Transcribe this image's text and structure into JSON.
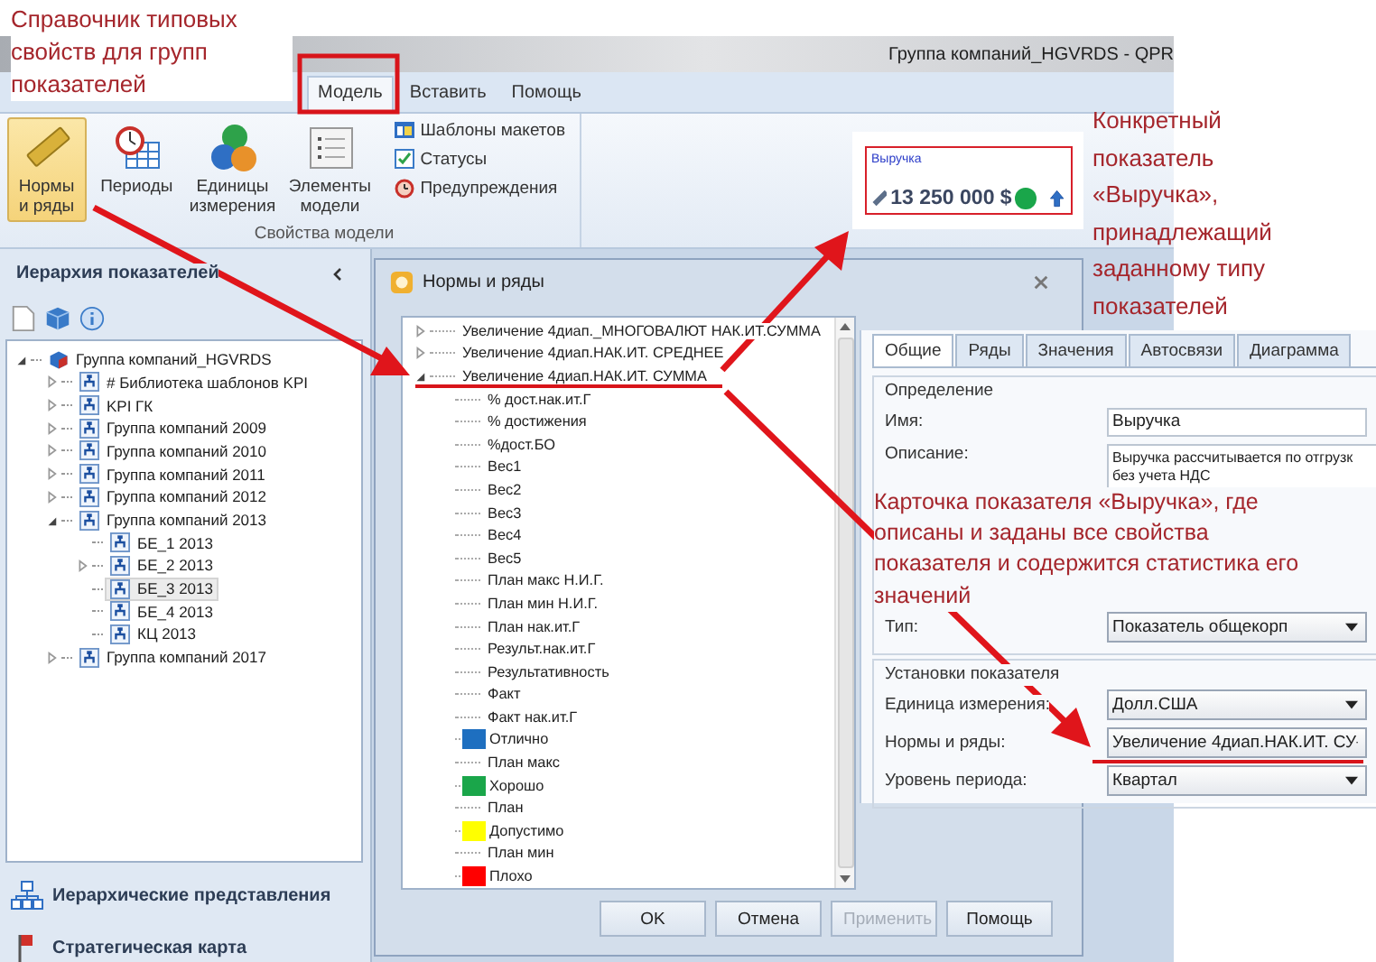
{
  "window": {
    "title": "Группа компаний_HGVRDS - QPR"
  },
  "menu": [
    {
      "label": "Модель",
      "selected": true
    },
    {
      "label": "Вставить",
      "selected": false
    },
    {
      "label": "Помощь",
      "selected": false
    }
  ],
  "ribbon": {
    "buttons": [
      {
        "lines": [
          "Нормы",
          "и ряды"
        ],
        "selected": true
      },
      {
        "lines": [
          "Периоды"
        ],
        "selected": false
      },
      {
        "lines": [
          "Единицы",
          "измерения"
        ],
        "selected": false
      },
      {
        "lines": [
          "Элементы",
          "модели"
        ],
        "selected": false
      }
    ],
    "small_items": [
      {
        "label": "Шаблоны макетов"
      },
      {
        "label": "Статусы"
      },
      {
        "label": "Предупреждения"
      }
    ],
    "group_label": "Свойства модели"
  },
  "hierarchy": {
    "title": "Иерархия показателей",
    "tree": [
      {
        "label": "Группа компаний_HGVRDS",
        "expanded": true,
        "selected": false,
        "children": [
          {
            "label": "# Библиотека шаблонов KPI",
            "expanded": false,
            "selected": false
          },
          {
            "label": "KPI ГК",
            "expanded": false,
            "selected": false
          },
          {
            "label": "Группа компаний 2009",
            "expanded": false,
            "selected": false
          },
          {
            "label": "Группа компаний 2010",
            "expanded": false,
            "selected": false
          },
          {
            "label": "Группа компаний 2011",
            "expanded": false,
            "selected": false
          },
          {
            "label": "Группа компаний 2012",
            "expanded": false,
            "selected": false
          },
          {
            "label": "Группа компаний 2013",
            "expanded": true,
            "selected": false,
            "children": [
              {
                "label": "БЕ_1 2013",
                "selected": false
              },
              {
                "label": "БЕ_2 2013",
                "expanded": false,
                "selected": false
              },
              {
                "label": "БЕ_3 2013",
                "selected": true
              },
              {
                "label": "БЕ_4 2013",
                "selected": false
              },
              {
                "label": "КЦ 2013",
                "selected": false
              }
            ]
          },
          {
            "label": "Группа компаний 2017",
            "expanded": false,
            "selected": false
          }
        ]
      }
    ],
    "nav": [
      {
        "label": "Иерархические представления"
      },
      {
        "label": "Стратегическая карта"
      }
    ]
  },
  "dialog": {
    "title": "Нормы и ряды",
    "tree": [
      {
        "label": "Увеличение 4диап._МНОГОВАЛЮТ НАК.ИТ.СУММА",
        "expanded": false
      },
      {
        "label": "Увеличение 4диап.НАК.ИТ. СРЕДНЕЕ",
        "expanded": false
      },
      {
        "label": "Увеличение 4диап.НАК.ИТ. СУММА",
        "expanded": true,
        "children": [
          {
            "label": "% дост.нак.ит.Г"
          },
          {
            "label": "% достижения"
          },
          {
            "label": "%дост.БО"
          },
          {
            "label": "Вес1"
          },
          {
            "label": "Вес2"
          },
          {
            "label": "Вес3"
          },
          {
            "label": "Вес4"
          },
          {
            "label": "Вес5"
          },
          {
            "label": "План макс Н.И.Г."
          },
          {
            "label": "План мин Н.И.Г."
          },
          {
            "label": "План нак.ит.Г"
          },
          {
            "label": "Результ.нак.ит.Г"
          },
          {
            "label": "Результативность"
          },
          {
            "label": "Факт"
          },
          {
            "label": "Факт нак.ит.Г"
          },
          {
            "label": "Отлично",
            "color": "#1e6fc0"
          },
          {
            "label": "План макс"
          },
          {
            "label": "Хорошо",
            "color": "#1aa64a"
          },
          {
            "label": "План"
          },
          {
            "label": "Допустимо",
            "color": "#ffff00"
          },
          {
            "label": "План мин"
          },
          {
            "label": "Плохо",
            "color": "#ff0000"
          }
        ]
      }
    ],
    "buttons": [
      {
        "label": "OK",
        "disabled": false
      },
      {
        "label": "Отмена",
        "disabled": false
      },
      {
        "label": "Применить",
        "disabled": true
      },
      {
        "label": "Помощь",
        "disabled": false
      }
    ]
  },
  "kpi_widget": {
    "title": "Выручка",
    "value": "13 250 000 $"
  },
  "card": {
    "tabs": [
      {
        "label": "Общие",
        "selected": true
      },
      {
        "label": "Ряды",
        "selected": false
      },
      {
        "label": "Значения",
        "selected": false
      },
      {
        "label": "Автосвязи",
        "selected": false
      },
      {
        "label": "Диаграмма",
        "selected": false
      }
    ],
    "definition": {
      "legend": "Определение",
      "name_label": "Имя:",
      "name_value": "Выручка",
      "description_label": "Описание:",
      "description_lines": [
        "Выручка рассчитывается по отгрузк",
        "без учета НДС"
      ],
      "type_label": "Тип:",
      "type_value": "Показатель общекорп"
    },
    "settings": {
      "legend": "Установки показателя",
      "rows": [
        {
          "label": "Единица измерения:",
          "value": "Долл.США"
        },
        {
          "label": "Нормы и ряды:",
          "value": "Увеличение 4диап.НАК.ИТ. СУ"
        },
        {
          "label": "Уровень периода:",
          "value": "Квартал"
        }
      ]
    }
  },
  "annotations": [
    {
      "lines": [
        "Справочник типовых",
        "свойств для групп",
        "показателей"
      ]
    },
    {
      "lines": [
        "Конкретный",
        "показатель",
        "«Выручка»,",
        "принадлежащий",
        "заданному типу",
        "показателей"
      ]
    },
    {
      "lines": [
        "Карточка показателя «Выручка», где",
        "описаны и заданы все свойства",
        "показателя и содержится статистика его",
        "значений"
      ]
    }
  ]
}
